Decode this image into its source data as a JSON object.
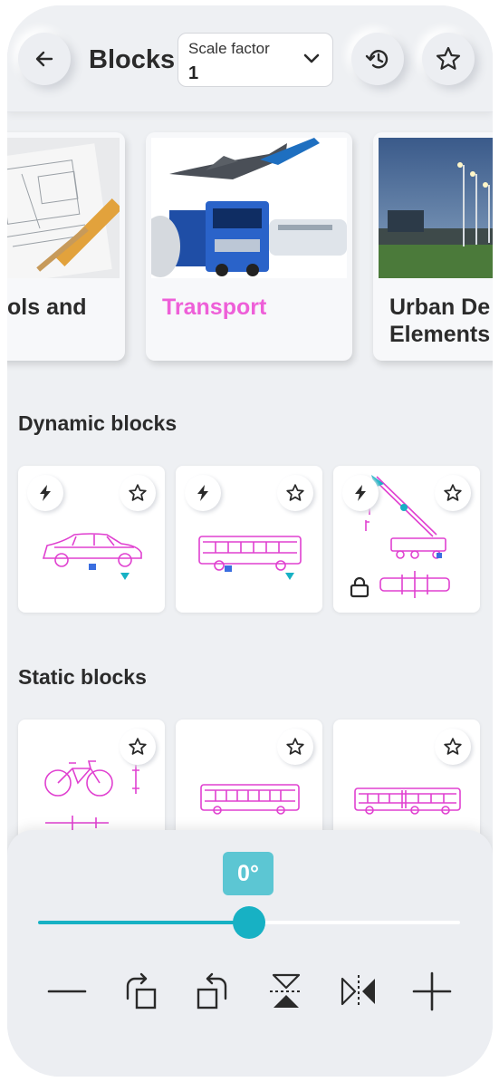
{
  "header": {
    "title": "Blocks",
    "scale_factor": {
      "label": "Scale factor",
      "value": "1"
    }
  },
  "categories": [
    {
      "label": "ols and"
    },
    {
      "label": "Transport",
      "selected": true
    },
    {
      "label": "Urban De Elements",
      "line1": "Urban De",
      "line2": "Elements"
    }
  ],
  "dynamic_section": {
    "title": "Dynamic blocks"
  },
  "dynamic_blocks": [
    {
      "name": "car"
    },
    {
      "name": "bus"
    },
    {
      "name": "crane"
    }
  ],
  "static_section": {
    "title": "Static blocks"
  },
  "static_blocks": [
    {
      "name": "bicycle"
    },
    {
      "name": "bus"
    },
    {
      "name": "articulated-bus"
    }
  ],
  "rotation": {
    "angle_label": "0°",
    "level_percent": 50
  },
  "colors": {
    "accent": "#17b1c4",
    "angle_badge": "#5cc6d3",
    "selected_text": "#ee5fd8",
    "block_line": "#e040d0"
  },
  "icons": [
    "back-arrow-icon",
    "chevron-down-icon",
    "history-icon",
    "star-icon",
    "lightning-icon",
    "lock-icon",
    "minus-icon",
    "rotate-right-icon",
    "rotate-left-icon",
    "flip-vertical-icon",
    "flip-horizontal-icon",
    "plus-icon"
  ]
}
